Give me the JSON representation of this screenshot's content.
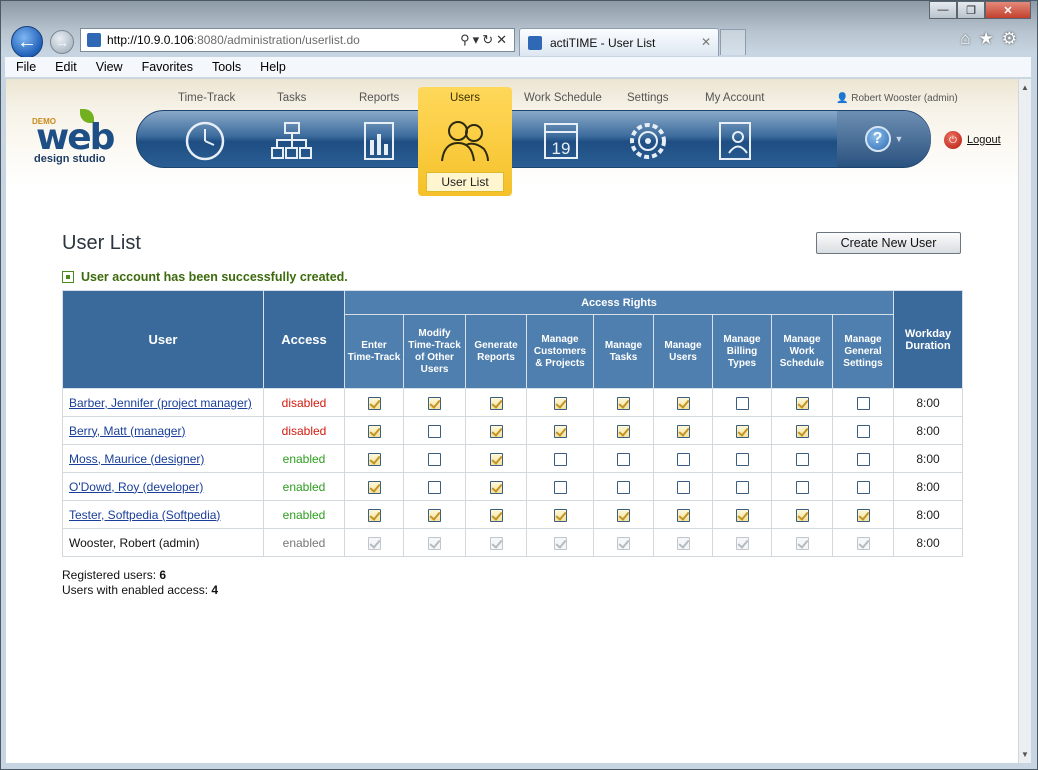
{
  "browser": {
    "url_host": "http://10.9.0.106",
    "url_path": ":8080/administration/userlist.do",
    "tab_title": "actiTIME - User List",
    "tab_close": "✕",
    "window_buttons": [
      "—",
      "❐",
      "✕"
    ]
  },
  "menu": [
    "File",
    "Edit",
    "View",
    "Favorites",
    "Tools",
    "Help"
  ],
  "app": {
    "logo": {
      "demo": "DEMO",
      "brand": "web",
      "tagline": "design studio"
    },
    "nav": [
      "Time-Track",
      "Tasks",
      "Reports",
      "Users",
      "Work Schedule",
      "Settings",
      "My Account"
    ],
    "active_nav": "Users",
    "active_sub": "User List",
    "user_info": "Robert Wooster (admin)",
    "help_icon": "?",
    "logout": "Logout",
    "calendar_day": "19"
  },
  "content": {
    "title": "User List",
    "create_button": "Create New User",
    "success_message": "User account has been successfully created.",
    "table": {
      "col_user": "User",
      "col_access": "Access",
      "group_header": "Access Rights",
      "col_workday": "Workday Duration",
      "rights_columns": [
        "Enter Time-Track",
        "Modify Time-Track of Other Users",
        "Generate Reports",
        "Manage Customers & Projects",
        "Manage Tasks",
        "Manage Users",
        "Manage Billing Types",
        "Manage Work Schedule",
        "Manage General Settings"
      ],
      "rows": [
        {
          "name": "Barber, Jennifer (project manager)",
          "access": "disabled",
          "rights": [
            1,
            1,
            1,
            1,
            1,
            1,
            0,
            1,
            0
          ],
          "duration": "8:00"
        },
        {
          "name": "Berry, Matt (manager)",
          "access": "disabled",
          "rights": [
            1,
            0,
            1,
            1,
            1,
            1,
            1,
            1,
            0
          ],
          "duration": "8:00"
        },
        {
          "name": "Moss, Maurice (designer)",
          "access": "enabled",
          "rights": [
            1,
            0,
            1,
            0,
            0,
            0,
            0,
            0,
            0
          ],
          "duration": "8:00"
        },
        {
          "name": "O'Dowd, Roy (developer)",
          "access": "enabled",
          "rights": [
            1,
            0,
            1,
            0,
            0,
            0,
            0,
            0,
            0
          ],
          "duration": "8:00"
        },
        {
          "name": "Tester, Softpedia (Softpedia)",
          "access": "enabled",
          "rights": [
            1,
            1,
            1,
            1,
            1,
            1,
            1,
            1,
            1
          ],
          "duration": "8:00"
        },
        {
          "name": "Wooster, Robert (admin)",
          "access": "enabled",
          "rights": [
            1,
            1,
            1,
            1,
            1,
            1,
            1,
            1,
            1
          ],
          "duration": "8:00",
          "admin": true
        }
      ]
    },
    "stats": {
      "registered_label": "Registered users:",
      "registered_value": "6",
      "enabled_label": "Users with enabled access:",
      "enabled_value": "4"
    }
  },
  "colors": {
    "accent": "#f5c12a",
    "nav": "#2a5e94",
    "header": "#4f7fae",
    "disabled": "#d21b0f",
    "enabled": "#2d9e1f"
  }
}
